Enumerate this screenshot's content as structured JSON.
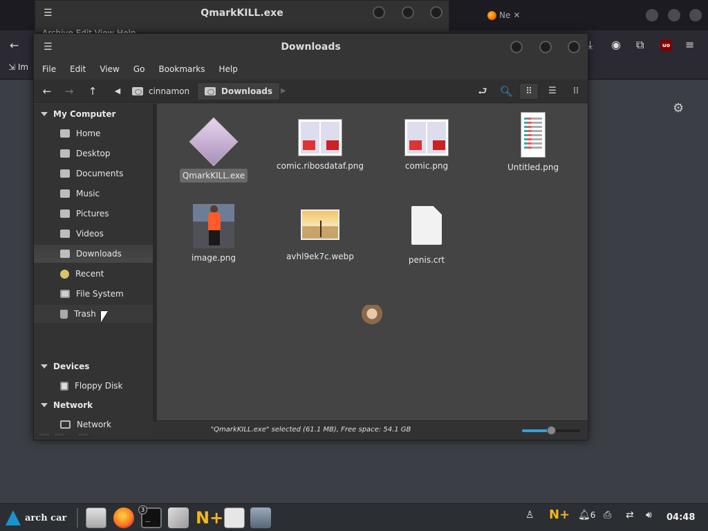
{
  "browser": {
    "tab_label": "Ne",
    "bookmark_label": "Im",
    "ublock_label": "uo"
  },
  "back_window": {
    "title": "QmarkKILL.exe",
    "menu_strip": "Archive  Edit  View  Help"
  },
  "window": {
    "title": "Downloads",
    "menu": [
      "File",
      "Edit",
      "View",
      "Go",
      "Bookmarks",
      "Help"
    ]
  },
  "toolbar": {
    "crumbs": [
      "cinnamon",
      "Downloads"
    ]
  },
  "sidebar": {
    "sections": [
      {
        "title": "My Computer",
        "items": [
          "Home",
          "Desktop",
          "Documents",
          "Music",
          "Pictures",
          "Videos",
          "Downloads",
          "Recent",
          "File System",
          "Trash"
        ]
      },
      {
        "title": "Devices",
        "items": [
          "Floppy Disk"
        ]
      },
      {
        "title": "Network",
        "items": [
          "Network"
        ]
      }
    ]
  },
  "files": [
    {
      "name": "QmarkKILL.exe",
      "selected": true
    },
    {
      "name": "comic.ribosdataf.png"
    },
    {
      "name": "comic.png"
    },
    {
      "name": "Untitled.png"
    },
    {
      "name": "image.png"
    },
    {
      "name": "avhl9ek7c.webp"
    },
    {
      "name": "penis.crt"
    }
  ],
  "statusbar": {
    "text": "\"QmarkKILL.exe\" selected (61.1 MB), Free space: 54.1 GB",
    "zoom_fraction": 0.5
  },
  "taskbar": {
    "menu_label": "arch car",
    "terminal_badge": "3",
    "notification_count": "6",
    "clock": "04:48"
  },
  "colors": {
    "accent": "#3aa0d8",
    "arch_blue": "#1793d1"
  }
}
